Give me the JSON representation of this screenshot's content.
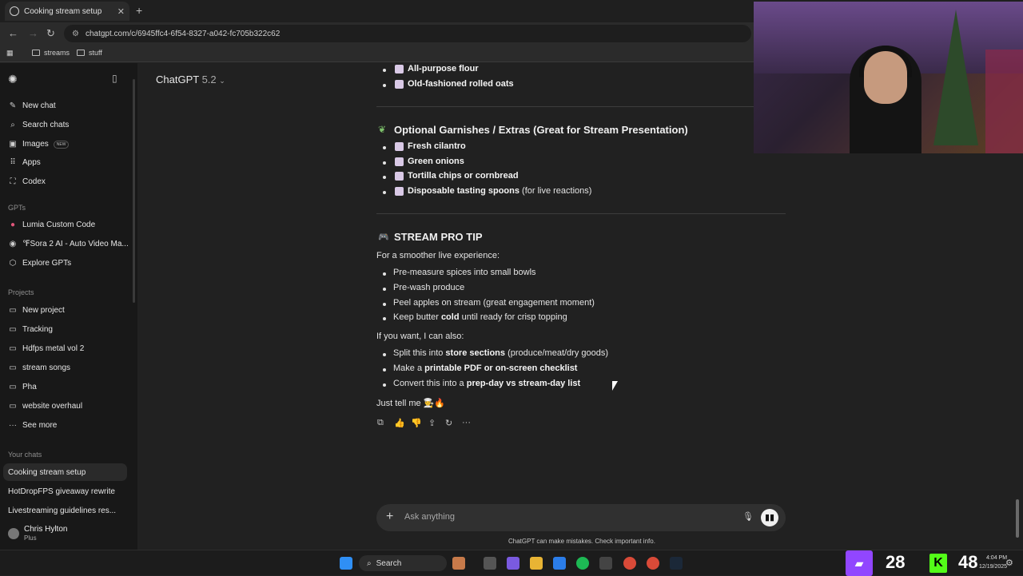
{
  "browser": {
    "tab_title": "Cooking stream setup",
    "url": "chatgpt.com/c/6945ffc4-6f54-8327-a042-fc705b322c62",
    "bookmarks": [
      "streams",
      "stuff"
    ]
  },
  "sidebar": {
    "top_items": [
      {
        "label": "New chat",
        "icon": "new-chat-icon"
      },
      {
        "label": "Search chats",
        "icon": "search-icon"
      },
      {
        "label": "Images",
        "icon": "images-icon",
        "badge": "NEW"
      },
      {
        "label": "Apps",
        "icon": "apps-icon"
      },
      {
        "label": "Codex",
        "icon": "codex-icon"
      }
    ],
    "gpts_header": "GPTs",
    "gpts": [
      "Lumia Custom Code",
      "℉Sora 2 AI - Auto Video Ma...",
      "Explore GPTs"
    ],
    "projects_header": "Projects",
    "projects": [
      "New project",
      "Tracking",
      "Hdfps metal vol 2",
      "stream songs",
      "Pha",
      "website overhaul",
      "See more"
    ],
    "chats_header": "Your chats",
    "chats": [
      "Cooking stream setup",
      "HotDropFPS giveaway rewrite",
      "Livestreaming guidelines res..."
    ],
    "user_name": "Chris Hylton",
    "user_plan": "Plus"
  },
  "header": {
    "model": "ChatGPT",
    "version": "5.2"
  },
  "message": {
    "top_items": [
      "All-purpose flour",
      "Old-fashioned rolled oats"
    ],
    "garnish_heading": "Optional Garnishes / Extras (Great for Stream Presentation)",
    "garnish_items": [
      {
        "bold": "Fresh cilantro",
        "rest": ""
      },
      {
        "bold": "Green onions",
        "rest": ""
      },
      {
        "bold": "Tortilla chips or cornbread",
        "rest": ""
      },
      {
        "bold": "Disposable tasting spoons",
        "rest": " (for live reactions)"
      }
    ],
    "tip_heading": "STREAM PRO TIP",
    "tip_intro": "For a smoother live experience:",
    "tip_items": [
      "Pre-measure spices into small bowls",
      "Pre-wash produce",
      "Peel apples on stream (great engagement moment)"
    ],
    "tip_butter_a": "Keep butter ",
    "tip_butter_b": "cold",
    "tip_butter_c": " until ready for crisp topping",
    "offer_intro": "If you want, I can also:",
    "offer1_a": "Split this into ",
    "offer1_b": "store sections",
    "offer1_c": " (produce/meat/dry goods)",
    "offer2_a": "Make a ",
    "offer2_b": "printable PDF or on-screen checklist",
    "offer3_a": "Convert this into a ",
    "offer3_b": "prep-day vs stream-day list",
    "closing": "Just tell me 👨‍🍳🔥"
  },
  "composer": {
    "placeholder": "Ask anything",
    "disclaimer": "ChatGPT can make mistakes. Check important info."
  },
  "taskbar": {
    "search": "Search",
    "counter_a": "28",
    "counter_b": "48",
    "time": "4:04 PM",
    "date": "12/19/2025"
  }
}
